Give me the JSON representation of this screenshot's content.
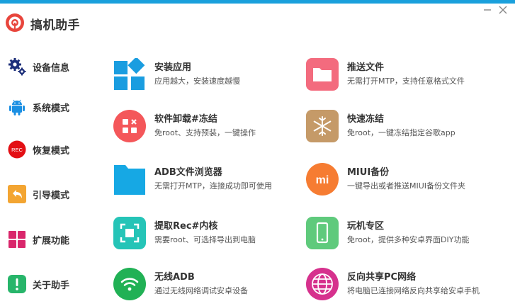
{
  "app": {
    "title": "搞机助手"
  },
  "sidebar": {
    "items": [
      {
        "label": "设备信息",
        "icon": "gears-icon"
      },
      {
        "label": "系统模式",
        "icon": "android-icon"
      },
      {
        "label": "恢复模式",
        "icon": "rec-icon",
        "badge": "REC"
      },
      {
        "label": "引导模式",
        "icon": "reply-arrow-icon"
      },
      {
        "label": "扩展功能",
        "icon": "grid-icon"
      },
      {
        "label": "关于助手",
        "icon": "info-icon"
      }
    ]
  },
  "features": [
    {
      "title": "安装应用",
      "desc": "应用越大，安装速度越慢",
      "icon": "install-icon",
      "color": "#1a9de0"
    },
    {
      "title": "推送文件",
      "desc": "无需打开MTP，支持任意格式文件",
      "icon": "folder-icon",
      "color": "#f36b7e"
    },
    {
      "title": "软件卸载#冻结",
      "desc": "免root、支持预装，一键操作",
      "icon": "uninstall-icon",
      "color": "#f4575a"
    },
    {
      "title": "快速冻结",
      "desc": "免root，一键冻结指定谷歌app",
      "icon": "snowflake-icon",
      "color": "#c59a68"
    },
    {
      "title": "ADB文件浏览器",
      "desc": "无需打开MTP，连接成功即可使用",
      "icon": "folder-icon",
      "color": "#16a8e4"
    },
    {
      "title": "MIUI备份",
      "desc": "一键导出或者推送MIUI备份文件夹",
      "icon": "mi-icon",
      "badge": "mi",
      "color": "#f67c32"
    },
    {
      "title": "提取Rec#内核",
      "desc": "需要root、可选择导出到电脑",
      "icon": "scan-icon",
      "color": "#25c4b7"
    },
    {
      "title": "玩机专区",
      "desc": "免root，提供多种安卓界面DIY功能",
      "icon": "phone-icon",
      "color": "#5fca7c"
    },
    {
      "title": "无线ADB",
      "desc": "通过无线网络调试安卓设备",
      "icon": "wifi-icon",
      "color": "#21b155"
    },
    {
      "title": "反向共享PC网络",
      "desc": "将电脑已连接网络反向共享给安卓手机",
      "icon": "globe-icon",
      "color": "#d6318d"
    }
  ]
}
